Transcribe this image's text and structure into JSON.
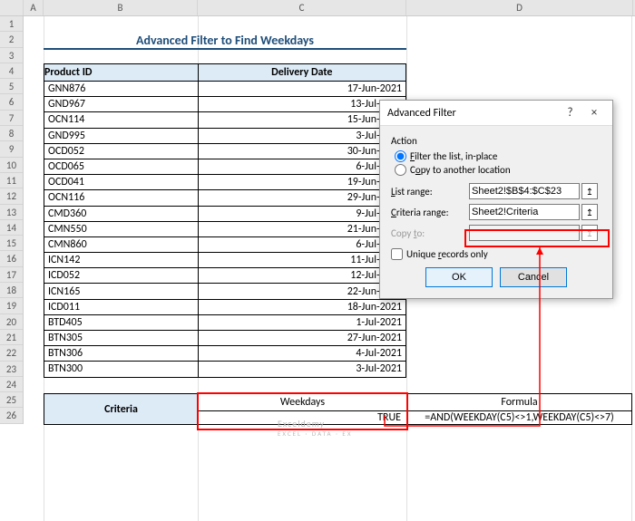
{
  "col_headers": [
    "A",
    "B",
    "C",
    "D"
  ],
  "row_headers": [
    "1",
    "2",
    "3",
    "4",
    "5",
    "6",
    "7",
    "8",
    "9",
    "10",
    "11",
    "12",
    "13",
    "14",
    "15",
    "16",
    "17",
    "18",
    "19",
    "20",
    "21",
    "22",
    "23",
    "24",
    "25",
    "26"
  ],
  "title": "Advanced Filter to Find Weekdays",
  "table": {
    "head_pid": "Product ID",
    "head_dd": "Delivery Date",
    "rows": [
      {
        "pid": "GNN876",
        "dd": "17-Jun-2021"
      },
      {
        "pid": "GND967",
        "dd": "13-Jul-2021"
      },
      {
        "pid": "OCN114",
        "dd": "15-Jun-2021"
      },
      {
        "pid": "GND995",
        "dd": "3-Jul-2021"
      },
      {
        "pid": "OCD052",
        "dd": "30-Jun-2021"
      },
      {
        "pid": "OCD065",
        "dd": "6-Jul-2021"
      },
      {
        "pid": "OCD041",
        "dd": "19-Jun-2021"
      },
      {
        "pid": "OCN116",
        "dd": "29-Jun-2021"
      },
      {
        "pid": "CMD360",
        "dd": "9-Jul-2021"
      },
      {
        "pid": "CMN550",
        "dd": "21-Jun-2021"
      },
      {
        "pid": "CMN860",
        "dd": "6-Jul-2021"
      },
      {
        "pid": "ICN142",
        "dd": "11-Jul-2021"
      },
      {
        "pid": "ICD052",
        "dd": "12-Jul-2021"
      },
      {
        "pid": "ICN165",
        "dd": "22-Jun-2021"
      },
      {
        "pid": "ICD011",
        "dd": "18-Jun-2021"
      },
      {
        "pid": "BTD405",
        "dd": "1-Jul-2021"
      },
      {
        "pid": "BTN305",
        "dd": "27-Jun-2021"
      },
      {
        "pid": "BTN306",
        "dd": "4-Jul-2021"
      },
      {
        "pid": "BTN300",
        "dd": "3-Jul-2021"
      }
    ]
  },
  "criteria": {
    "label": "Criteria",
    "col1": "Weekdays",
    "col2": "Formula",
    "val1": "TRUE",
    "val2": "=AND(WEEKDAY(C5)<>1,WEEKDAY(C5)<>7)"
  },
  "dialog": {
    "title": "Advanced Filter",
    "help": "?",
    "close": "×",
    "action_label": "Action",
    "opt_inplace": "Filter the list, in-place",
    "opt_copy": "Copy to another location",
    "list_range_label": "List range:",
    "list_range_value": "Sheet2!$B$4:$C$23",
    "criteria_range_label": "Criteria range:",
    "criteria_range_value": "Sheet2!Criteria",
    "copy_to_label": "Copy to:",
    "copy_to_value": "",
    "unique_label": "Unique records only",
    "ok": "OK",
    "cancel": "Cancel",
    "collapse": "↥"
  },
  "watermark": {
    "brand": "Exceldemy",
    "tag": "EXCEL · DATA · EX"
  }
}
